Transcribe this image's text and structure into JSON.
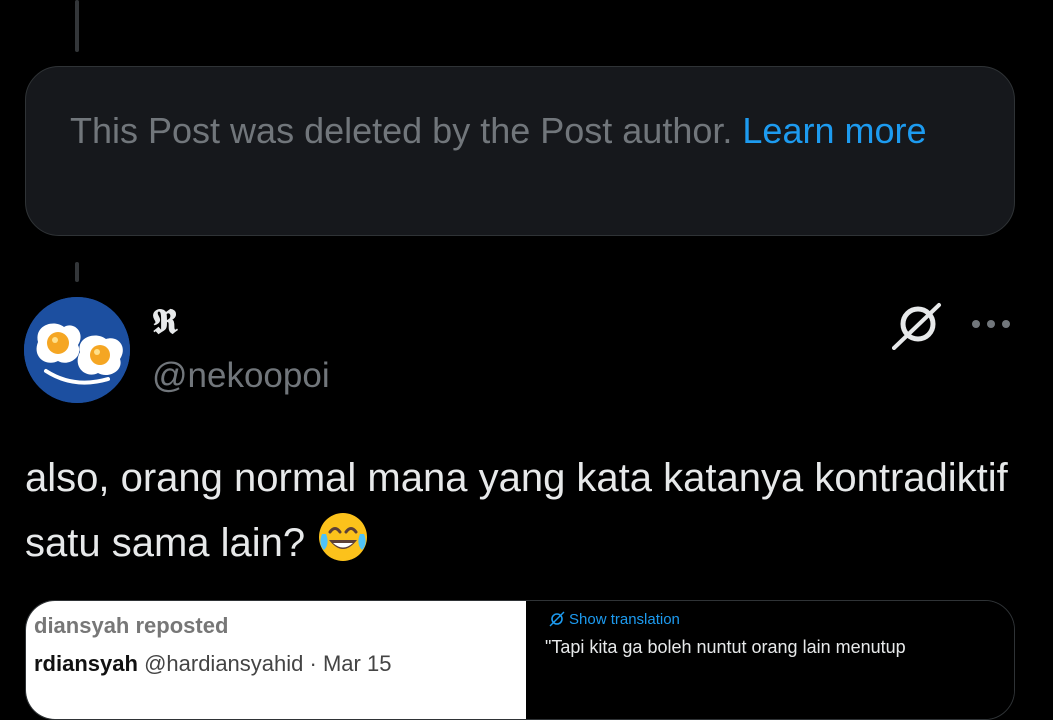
{
  "deleted_notice": {
    "text": "This Post was deleted by the Post author.",
    "link": "Learn more"
  },
  "post": {
    "display_name": "𝕽",
    "handle": "@nekoopoi",
    "text": "also, orang normal mana yang kata katanya kontradiktif satu sama lain?",
    "emoji": "face-with-tears-of-joy"
  },
  "quote": {
    "reposted_label": "diansyah reposted",
    "author_name": "rdiansyah",
    "author_handle": "@hardiansyahid",
    "date": "· Mar 15",
    "show_translation": "Show translation",
    "text": "\"Tapi kita ga boleh nuntut orang lain menutup"
  },
  "icons": {
    "grok": "grok-icon",
    "more": "more-icon",
    "translate": "translate-icon"
  },
  "colors": {
    "background": "#000000",
    "link": "#1d9bf0",
    "muted": "#71767b",
    "card": "#16181c"
  }
}
